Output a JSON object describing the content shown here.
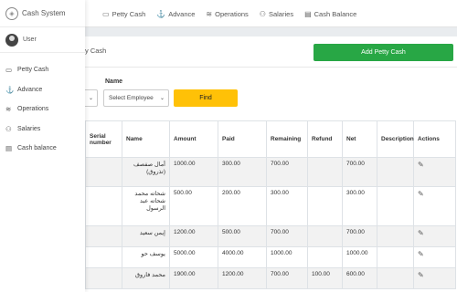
{
  "app": {
    "title": "Cash System",
    "user": "User"
  },
  "topnav": [
    {
      "label": "Petty Cash",
      "icon": "petty-cash-icon",
      "glyph": "▭"
    },
    {
      "label": "Advance",
      "icon": "advance-icon",
      "glyph": "⚓"
    },
    {
      "label": "Operations",
      "icon": "operations-icon",
      "glyph": "≋"
    },
    {
      "label": "Salaries",
      "icon": "salaries-icon",
      "glyph": "⚇"
    },
    {
      "label": "Cash Balance",
      "icon": "cash-balance-icon",
      "glyph": "▤"
    }
  ],
  "sidebar": [
    {
      "label": "Petty Cash",
      "icon": "petty-cash-icon",
      "glyph": "▭"
    },
    {
      "label": "Advance",
      "icon": "advance-icon",
      "glyph": "⚓"
    },
    {
      "label": "Operations",
      "icon": "operations-icon",
      "glyph": "≋"
    },
    {
      "label": "Salaries",
      "icon": "salaries-icon",
      "glyph": "⚇"
    },
    {
      "label": "Cash balance",
      "icon": "cash-balance-icon",
      "glyph": "▤"
    }
  ],
  "page": {
    "title_fragment": "y Cash",
    "add_button": "Add Petty Cash",
    "filter_label": "Name",
    "left_select_glyph": "⌄",
    "employee_select": "Select Employee",
    "find_button": "Find"
  },
  "table": {
    "headers": [
      "Serial number",
      "Name",
      "Amount",
      "Paid",
      "Remaining",
      "Refund",
      "Net",
      "Description",
      "Actions"
    ],
    "rows": [
      {
        "name": "أمال صفصف (تذروق)",
        "amount": "1000.00",
        "paid": "300.00",
        "remaining": "700.00",
        "refund": "",
        "net": "700.00",
        "description": ""
      },
      {
        "name": "شحاته محمد شحاته عبد الرسول",
        "amount": "500.00",
        "paid": "200.00",
        "remaining": "300.00",
        "refund": "",
        "net": "300.00",
        "description": ""
      },
      {
        "name": "إيمن سعيد",
        "amount": "1200.00",
        "paid": "500.00",
        "remaining": "700.00",
        "refund": "",
        "net": "700.00",
        "description": ""
      },
      {
        "name": "يوسف حو",
        "amount": "5000.00",
        "paid": "4000.00",
        "remaining": "1000.00",
        "refund": "",
        "net": "1000.00",
        "description": ""
      },
      {
        "name": "محمد فاروق",
        "amount": "1900.00",
        "paid": "1200.00",
        "remaining": "700.00",
        "refund": "100.00",
        "net": "600.00",
        "description": ""
      }
    ],
    "edit_glyph": "✎"
  },
  "colors": {
    "add_button": "#28a745",
    "find_button": "#ffc107"
  }
}
